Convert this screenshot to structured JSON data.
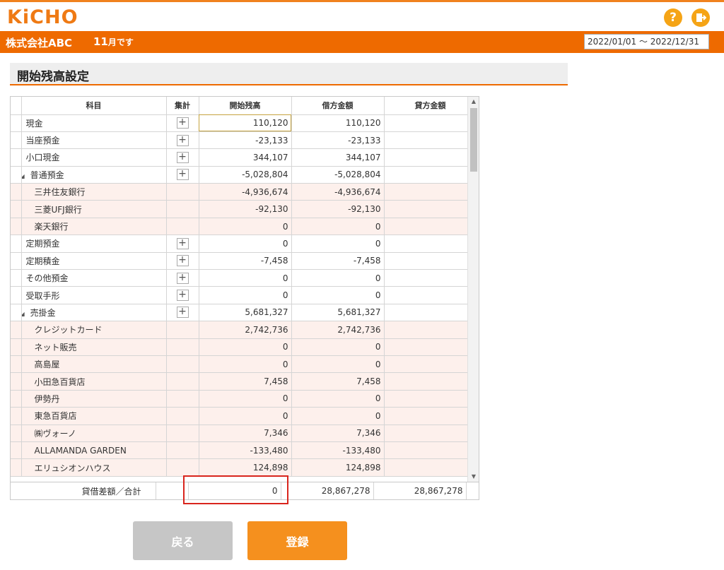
{
  "header": {
    "logo": "KiCHO",
    "help_icon": "?",
    "company": "株式会社ABC",
    "month_num": "11",
    "month_suffix": "月です",
    "period": "2022/01/01 ～ 2022/12/31"
  },
  "page": {
    "title": "開始残高設定"
  },
  "table": {
    "columns": [
      "科目",
      "集計",
      "開始残高",
      "借方金額",
      "貸方金額"
    ],
    "rows": [
      {
        "name": "現金",
        "plus": "+",
        "open": "110,120",
        "debit": "110,120",
        "credit": "",
        "sub": false,
        "expand": ""
      },
      {
        "name": "当座預金",
        "plus": "+",
        "open": "-23,133",
        "debit": "-23,133",
        "credit": "",
        "sub": false,
        "expand": ""
      },
      {
        "name": "小口現金",
        "plus": "+",
        "open": "344,107",
        "debit": "344,107",
        "credit": "",
        "sub": false,
        "expand": ""
      },
      {
        "name": "普通預金",
        "plus": "+",
        "open": "-5,028,804",
        "debit": "-5,028,804",
        "credit": "",
        "sub": false,
        "expand": "◢"
      },
      {
        "name": "三井住友銀行",
        "plus": "",
        "open": "-4,936,674",
        "debit": "-4,936,674",
        "credit": "",
        "sub": true,
        "expand": ""
      },
      {
        "name": "三菱UFJ銀行",
        "plus": "",
        "open": "-92,130",
        "debit": "-92,130",
        "credit": "",
        "sub": true,
        "expand": ""
      },
      {
        "name": "楽天銀行",
        "plus": "",
        "open": "0",
        "debit": "0",
        "credit": "",
        "sub": true,
        "expand": ""
      },
      {
        "name": "定期預金",
        "plus": "+",
        "open": "0",
        "debit": "0",
        "credit": "",
        "sub": false,
        "expand": ""
      },
      {
        "name": "定期積金",
        "plus": "+",
        "open": "-7,458",
        "debit": "-7,458",
        "credit": "",
        "sub": false,
        "expand": ""
      },
      {
        "name": "その他預金",
        "plus": "+",
        "open": "0",
        "debit": "0",
        "credit": "",
        "sub": false,
        "expand": ""
      },
      {
        "name": "受取手形",
        "plus": "+",
        "open": "0",
        "debit": "0",
        "credit": "",
        "sub": false,
        "expand": ""
      },
      {
        "name": "売掛金",
        "plus": "+",
        "open": "5,681,327",
        "debit": "5,681,327",
        "credit": "",
        "sub": false,
        "expand": "◢"
      },
      {
        "name": "クレジットカード",
        "plus": "",
        "open": "2,742,736",
        "debit": "2,742,736",
        "credit": "",
        "sub": true,
        "expand": ""
      },
      {
        "name": "ネット販売",
        "plus": "",
        "open": "0",
        "debit": "0",
        "credit": "",
        "sub": true,
        "expand": ""
      },
      {
        "name": "高島屋",
        "plus": "",
        "open": "0",
        "debit": "0",
        "credit": "",
        "sub": true,
        "expand": ""
      },
      {
        "name": "小田急百貨店",
        "plus": "",
        "open": "7,458",
        "debit": "7,458",
        "credit": "",
        "sub": true,
        "expand": ""
      },
      {
        "name": "伊勢丹",
        "plus": "",
        "open": "0",
        "debit": "0",
        "credit": "",
        "sub": true,
        "expand": ""
      },
      {
        "name": "東急百貨店",
        "plus": "",
        "open": "0",
        "debit": "0",
        "credit": "",
        "sub": true,
        "expand": ""
      },
      {
        "name": "㈱ヴォーノ",
        "plus": "",
        "open": "7,346",
        "debit": "7,346",
        "credit": "",
        "sub": true,
        "expand": ""
      },
      {
        "name": "ALLAMANDA GARDEN",
        "plus": "",
        "open": "-133,480",
        "debit": "-133,480",
        "credit": "",
        "sub": true,
        "expand": ""
      },
      {
        "name": "エリュシオンハウス",
        "plus": "",
        "open": "124,898",
        "debit": "124,898",
        "credit": "",
        "sub": true,
        "expand": ""
      }
    ],
    "scroll_up": "▲",
    "scroll_down": "▼"
  },
  "footer": {
    "label": "貸借差額／合計",
    "open": "0",
    "debit": "28,867,278",
    "credit": "28,867,278"
  },
  "buttons": {
    "back": "戻る",
    "save": "登録"
  },
  "colors": {
    "accent": "#ee6a00",
    "save": "#f5901e",
    "back": "#c6c6c6",
    "highlight": "#d9251d"
  }
}
